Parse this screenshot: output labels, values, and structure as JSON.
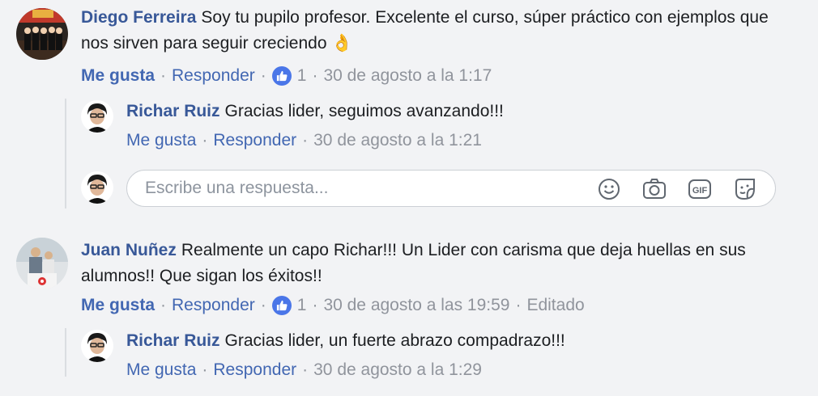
{
  "comments": [
    {
      "author": "Diego Ferreira",
      "text": "Soy tu pupilo profesor. Excelente el curso, súper práctico con ejemplos que nos sirven para seguir creciendo",
      "emoji": "👌",
      "like_label": "Me gusta",
      "reply_label": "Responder",
      "reaction_count": "1",
      "timestamp": "30 de agosto a la 1:17",
      "replies": [
        {
          "author": "Richar Ruiz",
          "text": "Gracias lider, seguimos avanzando!!!",
          "like_label": "Me gusta",
          "reply_label": "Responder",
          "timestamp": "30 de agosto a la 1:21"
        }
      ],
      "reply_box": {
        "placeholder": "Escribe una respuesta..."
      }
    },
    {
      "author": "Juan Nuñez",
      "text": "Realmente un capo Richar!!! Un Lider con carisma que deja huellas en sus alumnos!! Que sigan los éxitos!!",
      "like_label": "Me gusta",
      "reply_label": "Responder",
      "reaction_count": "1",
      "timestamp": "30 de agosto a las 19:59",
      "edited_label": "Editado",
      "replies": [
        {
          "author": "Richar Ruiz",
          "text": "Gracias lider, un fuerte abrazo compadrazo!!!",
          "like_label": "Me gusta",
          "reply_label": "Responder",
          "timestamp": "30 de agosto a la 1:29"
        }
      ]
    }
  ],
  "colors": {
    "background": "#f2f3f5",
    "author": "#385898",
    "link": "#4267b2",
    "meta": "#90949c",
    "reaction": "#4a76e8"
  },
  "icons": {
    "reaction": "thumbs-up-icon",
    "reply_box": [
      "emoji-icon",
      "camera-icon",
      "gif-icon",
      "sticker-icon"
    ]
  }
}
